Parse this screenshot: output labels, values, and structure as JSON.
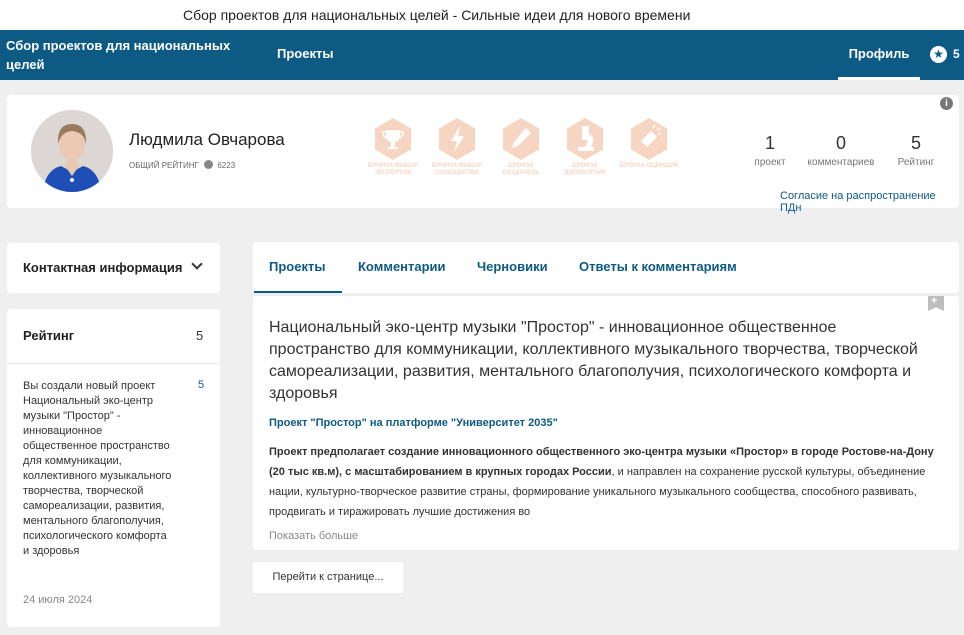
{
  "window": {
    "title": "Сбор проектов для национальных целей - Сильные идеи для нового времени"
  },
  "topbar": {
    "site_title": "Сбор проектов для национальных целей",
    "nav_projects": "Проекты",
    "nav_profile": "Профиль",
    "star_count": "5"
  },
  "profile": {
    "name": "Людмила Овчарова",
    "rating_label": "общий рейтинг",
    "rating_points": "6223",
    "badges": [
      {
        "icon": "trophy-icon",
        "label": "бронза выбор экспертов"
      },
      {
        "icon": "lightning-icon",
        "label": "бронза выбор сообщества"
      },
      {
        "icon": "pencil-icon",
        "label": "бронза создатель"
      },
      {
        "icon": "microscope-icon",
        "label": "бронза доработчик"
      },
      {
        "icon": "flashlight-icon",
        "label": "бронза оценщик"
      }
    ],
    "badge_color": "#f6d6c3",
    "stats": [
      {
        "value": "1",
        "label": "проект"
      },
      {
        "value": "0",
        "label": "комментариев"
      },
      {
        "value": "5",
        "label": "Рейтинг"
      }
    ],
    "consent_link": "Согласие на распространение ПДн"
  },
  "sidebar": {
    "contact_title": "Контактная информация",
    "rating_title": "Рейтинг",
    "rating_value": "5",
    "activity": {
      "text": "Вы создали новый проект Национальный эко-центр музыки \"Простор\" - инновационное общественное пространство для коммуникации, коллективного музыкального творчества, творческой самореализации, развития, ментального благополучия, психологического комфорта и здоровья",
      "points": "5",
      "date": "24 июля 2024"
    }
  },
  "tabs": [
    {
      "label": "Проекты",
      "active": true
    },
    {
      "label": "Комментарии"
    },
    {
      "label": "Черновики"
    },
    {
      "label": "Ответы к комментариям"
    }
  ],
  "project": {
    "title": "Национальный эко-центр музыки \"Простор\" - инновационное общественное пространство для коммуникации, коллективного музыкального творчества, творческой самореализации, развития, ментального благополучия, психологического комфорта и здоровья",
    "subtitle": "Проект \"Простор\" на платформе \"Университет 2035\"",
    "desc_bold": "Проект предполагает создание инновационного общественного эко-центра музыки «Простор» в городе Ростове-на-Дону (20 тыс кв.м), с масштабированием в крупных городах России",
    "desc_rest": ", и направлен на сохранение русской культуры, объединение нации, культурно-творческое развитие страны, формирование уникального музыкального сообщества, способного развивать, продвигать и тиражировать лучшие достижения во",
    "show_more": "Показать больше"
  },
  "goto_button": "Перейти к странице...",
  "colors": {
    "brand": "#0d5a84",
    "background": "#efefef"
  }
}
